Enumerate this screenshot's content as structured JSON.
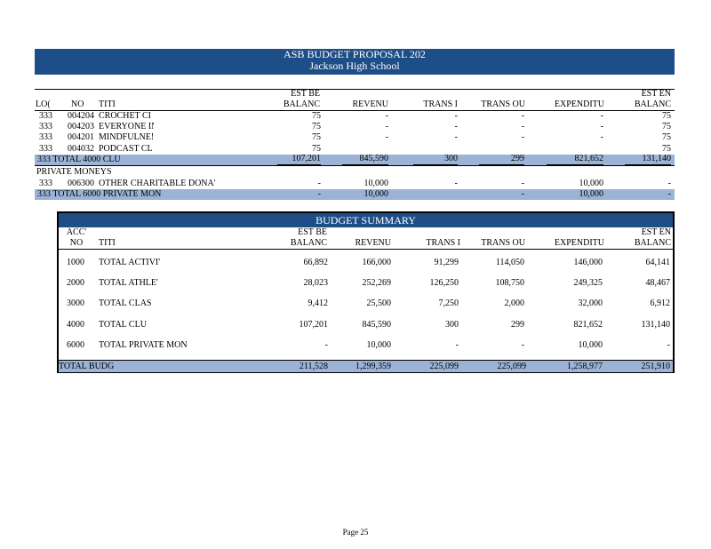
{
  "banner": {
    "title": "ASB BUDGET PROPOSAL 202",
    "school": "Jackson High School"
  },
  "detail": {
    "headers": {
      "loc": "LO(",
      "no": "NO",
      "title": "TITI",
      "est_beg_top": "EST BE",
      "est_beg_bottom": "BALANC",
      "revenue": "REVENU",
      "trans_in": "TRANS I",
      "trans_out": "TRANS OU",
      "expenditures": "EXPENDITU",
      "est_end_top": "EST EN",
      "est_end_bottom": "BALANC"
    },
    "club_rows": [
      {
        "loc": "333",
        "no": "004204",
        "title": "CROCHET CI",
        "est_beg": "75",
        "revenue": "-",
        "trans_in": "-",
        "trans_out": "-",
        "exp": "-",
        "est_end": "75"
      },
      {
        "loc": "333",
        "no": "004203",
        "title": "EVERYONE IN ST",
        "est_beg": "75",
        "revenue": "-",
        "trans_in": "-",
        "trans_out": "-",
        "exp": "-",
        "est_end": "75"
      },
      {
        "loc": "333",
        "no": "004201",
        "title": "MINDFULNE!",
        "est_beg": "75",
        "revenue": "-",
        "trans_in": "-",
        "trans_out": "-",
        "exp": "-",
        "est_end": "75"
      },
      {
        "loc": "333",
        "no": "004032",
        "title": "PODCAST CL",
        "est_beg": "75",
        "revenue": "",
        "trans_in": "",
        "trans_out": "",
        "exp": "",
        "est_end": "75"
      }
    ],
    "club_total": {
      "label": "333  TOTAL 4000 CLU",
      "est_beg": "107,201",
      "revenue": "845,590",
      "trans_in": "300",
      "trans_out": "299",
      "exp": "821,652",
      "est_end": "131,140"
    },
    "private_header": "PRIVATE MONEYS",
    "private_rows": [
      {
        "loc": "333",
        "no": "006300",
        "title": "OTHER CHARITABLE DONA'",
        "est_beg": "-",
        "revenue": "10,000",
        "trans_in": "-",
        "trans_out": "-",
        "exp": "10,000",
        "est_end": "-"
      }
    ],
    "private_total": {
      "label": "333  TOTAL 6000 PRIVATE MON",
      "est_beg": "-",
      "revenue": "10,000",
      "trans_in": "",
      "trans_out": "-",
      "exp": "10,000",
      "est_end": "-"
    }
  },
  "summary": {
    "title": "BUDGET SUMMARY",
    "headers": {
      "acct_top": "ACC'",
      "acct_bottom": "NO",
      "title": "TITI",
      "est_beg_top": "EST BE",
      "est_beg_bottom": "BALANC",
      "revenue": "REVENU",
      "trans_in": "TRANS I",
      "trans_out": "TRANS OU",
      "expenditures": "EXPENDITU",
      "est_end_top": "EST EN",
      "est_end_bottom": "BALANC"
    },
    "rows": [
      {
        "acct": "1000",
        "title": "TOTAL ACTIVI'",
        "est_beg": "66,892",
        "revenue": "166,000",
        "trans_in": "91,299",
        "trans_out": "114,050",
        "exp": "146,000",
        "est_end": "64,141"
      },
      {
        "acct": "2000",
        "title": "TOTAL ATHLE'",
        "est_beg": "28,023",
        "revenue": "252,269",
        "trans_in": "126,250",
        "trans_out": "108,750",
        "exp": "249,325",
        "est_end": "48,467"
      },
      {
        "acct": "3000",
        "title": "TOTAL CLAS",
        "est_beg": "9,412",
        "revenue": "25,500",
        "trans_in": "7,250",
        "trans_out": "2,000",
        "exp": "32,000",
        "est_end": "6,912"
      },
      {
        "acct": "4000",
        "title": "TOTAL CLU",
        "est_beg": "107,201",
        "revenue": "845,590",
        "trans_in": "300",
        "trans_out": "299",
        "exp": "821,652",
        "est_end": "131,140"
      },
      {
        "acct": "6000",
        "title": "TOTAL PRIVATE MON",
        "est_beg": "-",
        "revenue": "10,000",
        "trans_in": "-",
        "trans_out": "-",
        "exp": "10,000",
        "est_end": "-"
      }
    ],
    "total": {
      "label": "TOTAL BUDG",
      "est_beg": "211,528",
      "revenue": "1,299,359",
      "trans_in": "225,099",
      "trans_out": "225,099",
      "exp": "1,258,977",
      "est_end": "251,910"
    }
  },
  "footer": {
    "page": "Page 25"
  },
  "colors": {
    "banner": "#1e4e87",
    "total_row": "#9ab3d6"
  }
}
